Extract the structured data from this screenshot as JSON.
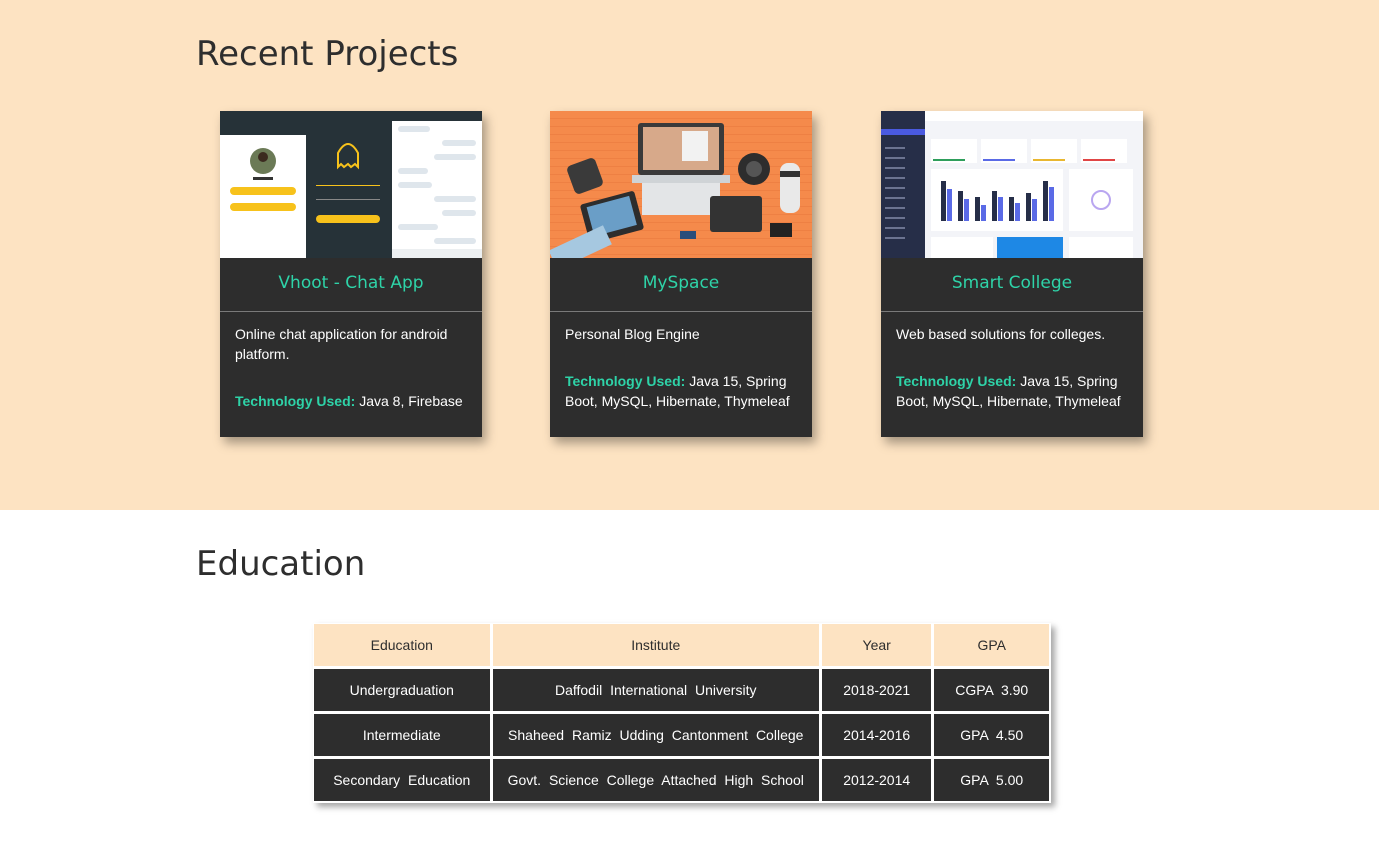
{
  "projects": {
    "title": "Recent Projects",
    "tech_label": "Technology Used:",
    "items": [
      {
        "title": "Vhoot - Chat App",
        "description": "Online chat application for android platform.",
        "technology": "Java 8, Firebase"
      },
      {
        "title": "MySpace",
        "description": "Personal Blog Engine",
        "technology": "Java 15, Spring Boot, MySQL, Hibernate, Thymeleaf"
      },
      {
        "title": "Smart College",
        "description": "Web based solutions for colleges.",
        "technology": "Java 15, Spring Boot, MySQL, Hibernate, Thymeleaf"
      }
    ]
  },
  "education": {
    "title": "Education",
    "headers": [
      "Education",
      "Institute",
      "Year",
      "GPA"
    ],
    "rows": [
      [
        "Undergraduation",
        "Daffodil International University",
        "2018-2021",
        "CGPA 3.90"
      ],
      [
        "Intermediate",
        "Shaheed Ramiz Udding Cantonment College",
        "2014-2016",
        "GPA 4.50"
      ],
      [
        "Secondary Education",
        "Govt. Science College Attached High School",
        "2012-2014",
        "GPA 5.00"
      ]
    ]
  },
  "colors": {
    "accent": "#2ed3a8",
    "section_bg": "#fde3c2",
    "card_bg": "#2d2d2d"
  }
}
